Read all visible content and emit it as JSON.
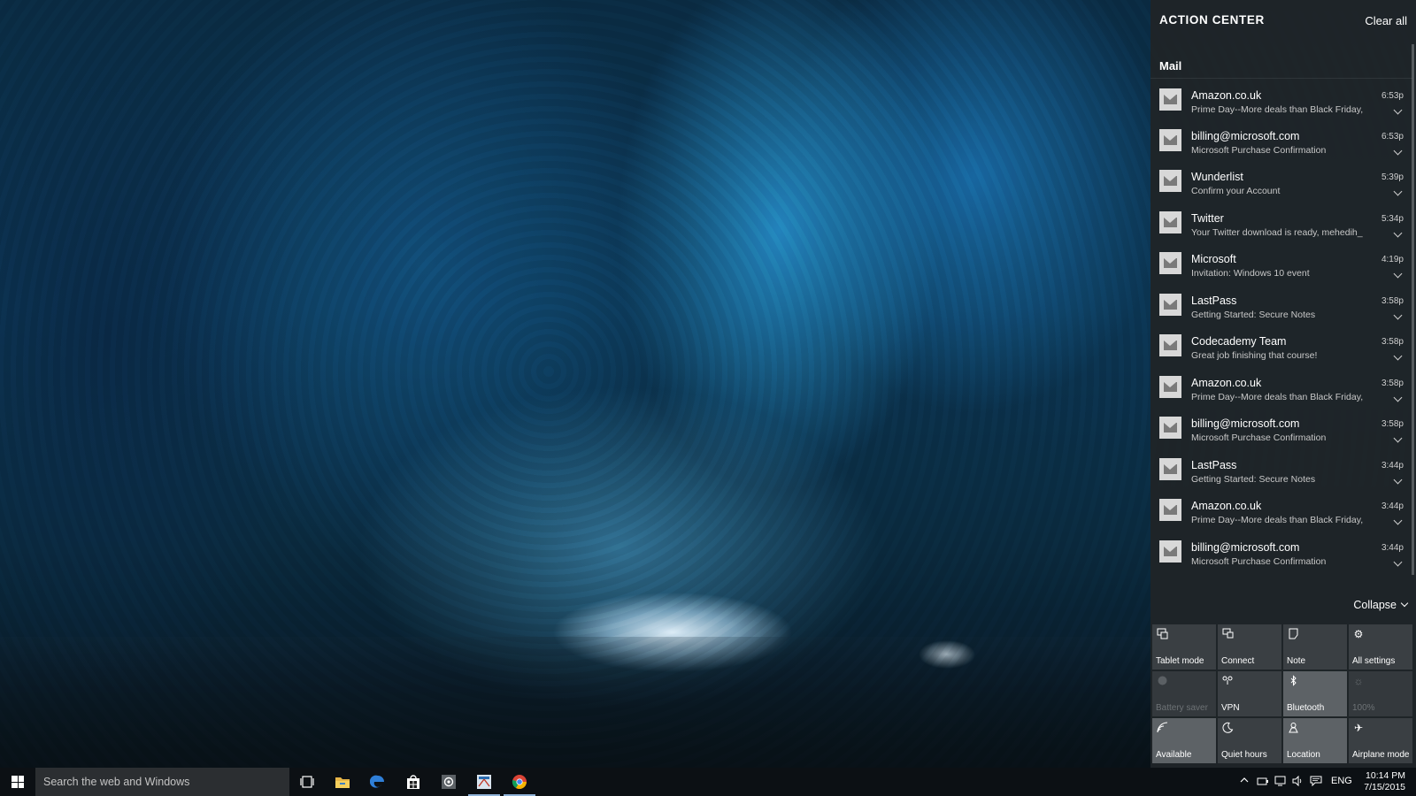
{
  "action_center": {
    "title": "ACTION CENTER",
    "clear_all": "Clear all",
    "group_label": "Mail",
    "notifications": [
      {
        "sender": "Amazon.co.uk",
        "subject": "Prime Day--More deals than Black Friday,",
        "time": "6:53p"
      },
      {
        "sender": "billing@microsoft.com",
        "subject": "Microsoft Purchase Confirmation",
        "time": "6:53p"
      },
      {
        "sender": "Wunderlist",
        "subject": "Confirm your Account",
        "time": "5:39p"
      },
      {
        "sender": "Twitter",
        "subject": "Your Twitter download is ready, mehedih_",
        "time": "5:34p"
      },
      {
        "sender": "Microsoft",
        "subject": "Invitation: Windows 10 event",
        "time": "4:19p"
      },
      {
        "sender": "LastPass",
        "subject": "Getting Started: Secure Notes",
        "time": "3:58p"
      },
      {
        "sender": "Codecademy Team",
        "subject": "Great job finishing that course!",
        "time": "3:58p"
      },
      {
        "sender": "Amazon.co.uk",
        "subject": "Prime Day--More deals than Black Friday,",
        "time": "3:58p"
      },
      {
        "sender": "billing@microsoft.com",
        "subject": "Microsoft Purchase Confirmation",
        "time": "3:58p"
      },
      {
        "sender": "LastPass",
        "subject": "Getting Started: Secure Notes",
        "time": "3:44p"
      },
      {
        "sender": "Amazon.co.uk",
        "subject": "Prime Day--More deals than Black Friday,",
        "time": "3:44p"
      },
      {
        "sender": "billing@microsoft.com",
        "subject": "Microsoft Purchase Confirmation",
        "time": "3:44p"
      }
    ],
    "collapse_label": "Collapse",
    "quick_actions": [
      {
        "label": "Tablet mode",
        "icon": "tablet-mode-icon",
        "state": "off"
      },
      {
        "label": "Connect",
        "icon": "connect-icon",
        "state": "off"
      },
      {
        "label": "Note",
        "icon": "note-icon",
        "state": "off"
      },
      {
        "label": "All settings",
        "icon": "gear-icon",
        "state": "off"
      },
      {
        "label": "Battery saver",
        "icon": "battery-saver-icon",
        "state": "disabled"
      },
      {
        "label": "VPN",
        "icon": "vpn-icon",
        "state": "off"
      },
      {
        "label": "Bluetooth",
        "icon": "bluetooth-icon",
        "state": "on"
      },
      {
        "label": "100%",
        "icon": "brightness-icon",
        "state": "disabled"
      },
      {
        "label": "Available",
        "icon": "wifi-icon",
        "state": "on"
      },
      {
        "label": "Quiet hours",
        "icon": "moon-icon",
        "state": "off"
      },
      {
        "label": "Location",
        "icon": "location-icon",
        "state": "on"
      },
      {
        "label": "Airplane mode",
        "icon": "airplane-icon",
        "state": "off"
      }
    ]
  },
  "taskbar": {
    "search_placeholder": "Search the web and Windows",
    "pinned": [
      "task-view-icon",
      "file-explorer-icon",
      "edge-icon",
      "store-icon",
      "media-app-icon",
      "snipping-app-icon",
      "chrome-icon"
    ],
    "tray": {
      "language": "ENG",
      "time": "10:14 PM",
      "date": "7/15/2015"
    }
  },
  "colors": {
    "panel_bg": "#1f2428",
    "tile_off": "#3a3f43",
    "tile_on": "#5d6266",
    "taskbar_bg": "#0c1014",
    "search_bg": "#2b2e31"
  }
}
